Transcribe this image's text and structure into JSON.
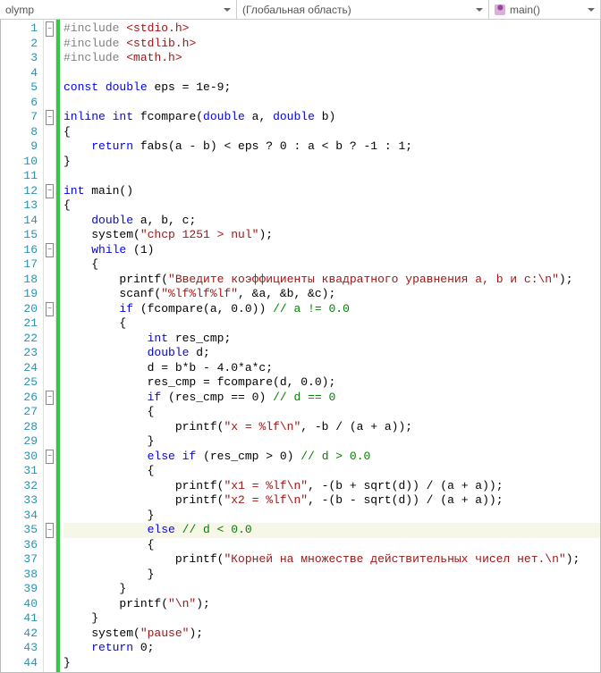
{
  "dropdowns": {
    "project": "olymp",
    "scope": "(Глобальная область)",
    "function": "main()"
  },
  "active_line": 35,
  "lines": [
    {
      "n": 1,
      "fold": "minus",
      "html": "<span class='pp'>#include</span> <span class='inc'>&lt;stdio.h&gt;</span>"
    },
    {
      "n": 2,
      "html": "<span class='pp'>#include</span> <span class='inc'>&lt;stdlib.h&gt;</span>"
    },
    {
      "n": 3,
      "html": "<span class='pp'>#include</span> <span class='inc'>&lt;math.h&gt;</span>"
    },
    {
      "n": 4,
      "html": ""
    },
    {
      "n": 5,
      "html": "<span class='kw'>const</span> <span class='kw'>double</span> eps = 1e-9;"
    },
    {
      "n": 6,
      "html": ""
    },
    {
      "n": 7,
      "fold": "minus",
      "html": "<span class='kw'>inline</span> <span class='kw'>int</span> fcompare(<span class='kw'>double</span> a, <span class='kw'>double</span> b)"
    },
    {
      "n": 8,
      "html": "{"
    },
    {
      "n": 9,
      "html": "    <span class='kw'>return</span> fabs(a - b) &lt; eps ? 0 : a &lt; b ? -1 : 1;"
    },
    {
      "n": 10,
      "html": "}"
    },
    {
      "n": 11,
      "html": ""
    },
    {
      "n": 12,
      "fold": "minus",
      "html": "<span class='kw'>int</span> main()"
    },
    {
      "n": 13,
      "html": "{"
    },
    {
      "n": 14,
      "html": "    <span class='kw'>double</span> a, b, c;"
    },
    {
      "n": 15,
      "html": "    system(<span class='str'>\"chcp 1251 &gt; nul\"</span>);"
    },
    {
      "n": 16,
      "fold": "minus",
      "html": "    <span class='kw'>while</span> (1)"
    },
    {
      "n": 17,
      "html": "    {"
    },
    {
      "n": 18,
      "html": "        printf(<span class='str'>\"Введите коэффициенты квадратного уравнения a, b и c:\\n\"</span>);"
    },
    {
      "n": 19,
      "html": "        scanf(<span class='str'>\"%lf%lf%lf\"</span>, &amp;a, &amp;b, &amp;c);"
    },
    {
      "n": 20,
      "fold": "minus",
      "html": "        <span class='kw'>if</span> (fcompare(a, 0.0)) <span class='com'>// a != 0.0</span>"
    },
    {
      "n": 21,
      "html": "        {"
    },
    {
      "n": 22,
      "html": "            <span class='kw'>int</span> res_cmp;"
    },
    {
      "n": 23,
      "html": "            <span class='kw'>double</span> d;"
    },
    {
      "n": 24,
      "html": "            d = b*b - 4.0*a*c;"
    },
    {
      "n": 25,
      "html": "            res_cmp = fcompare(d, 0.0);"
    },
    {
      "n": 26,
      "fold": "minus",
      "html": "            <span class='kw'>if</span> (res_cmp == 0) <span class='com'>// d == 0</span>"
    },
    {
      "n": 27,
      "html": "            {"
    },
    {
      "n": 28,
      "html": "                printf(<span class='str'>\"x = %lf\\n\"</span>, -b / (a + a));"
    },
    {
      "n": 29,
      "html": "            }"
    },
    {
      "n": 30,
      "fold": "minus",
      "html": "            <span class='kw'>else</span> <span class='kw'>if</span> (res_cmp &gt; 0) <span class='com'>// d &gt; 0.0</span>"
    },
    {
      "n": 31,
      "html": "            {"
    },
    {
      "n": 32,
      "html": "                printf(<span class='str'>\"x1 = %lf\\n\"</span>, -(b + sqrt(d)) / (a + a));"
    },
    {
      "n": 33,
      "html": "                printf(<span class='str'>\"x2 = %lf\\n\"</span>, -(b - sqrt(d)) / (a + a));"
    },
    {
      "n": 34,
      "html": "            }"
    },
    {
      "n": 35,
      "fold": "minus",
      "html": "            <span class='kw'>else</span> <span class='com'>// d &lt; 0.0</span>"
    },
    {
      "n": 36,
      "html": "            {"
    },
    {
      "n": 37,
      "html": "                printf(<span class='str'>\"Корней на множестве действительных чисел нет.\\n\"</span>);"
    },
    {
      "n": 38,
      "html": "            }"
    },
    {
      "n": 39,
      "html": "        }"
    },
    {
      "n": 40,
      "html": "        printf(<span class='str'>\"\\n\"</span>);"
    },
    {
      "n": 41,
      "html": "    }"
    },
    {
      "n": 42,
      "html": "    system(<span class='str'>\"pause\"</span>);"
    },
    {
      "n": 43,
      "html": "    <span class='kw'>return</span> 0;"
    },
    {
      "n": 44,
      "html": "}"
    }
  ]
}
